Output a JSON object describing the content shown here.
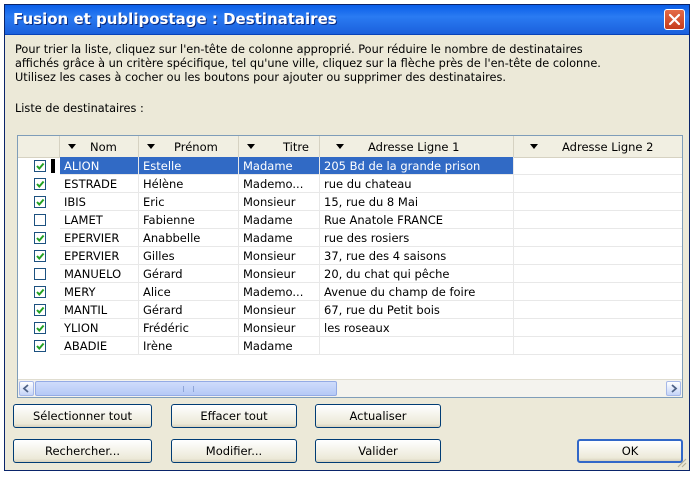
{
  "window": {
    "title": "Fusion et publipostage : Destinataires",
    "close_icon": "close-icon"
  },
  "description": {
    "line1": "Pour trier la liste, cliquez sur l'en-tête de colonne approprié. Pour réduire le nombre de destinataires",
    "line2": "affichés grâce à un critère spécifique, tel qu'une ville, cliquez sur la flèche près de l'en-tête de colonne.",
    "line3": "Utilisez les cases à cocher ou les boutons pour ajouter ou supprimer des destinataires."
  },
  "list": {
    "label": "Liste de destinataires :",
    "columns": [
      "Nom",
      "Prénom",
      "Titre",
      "Adresse Ligne 1",
      "Adresse Ligne 2"
    ],
    "rows": [
      {
        "checked": true,
        "selected": true,
        "nom": "ALION",
        "prenom": "Estelle",
        "titre": "Madame",
        "adresse1": "205 Bd de la grande prison",
        "adresse2": ""
      },
      {
        "checked": true,
        "selected": false,
        "nom": "ESTRADE",
        "prenom": "Hélène",
        "titre": "Mademo...",
        "adresse1": "rue du chateau",
        "adresse2": ""
      },
      {
        "checked": true,
        "selected": false,
        "nom": "IBIS",
        "prenom": "Eric",
        "titre": "Monsieur",
        "adresse1": "15, rue du 8 Mai",
        "adresse2": ""
      },
      {
        "checked": false,
        "selected": false,
        "nom": "LAMET",
        "prenom": "Fabienne",
        "titre": "Madame",
        "adresse1": "Rue Anatole FRANCE",
        "adresse2": ""
      },
      {
        "checked": true,
        "selected": false,
        "nom": "EPERVIER",
        "prenom": "Anabbelle",
        "titre": "Madame",
        "adresse1": "rue des rosiers",
        "adresse2": ""
      },
      {
        "checked": true,
        "selected": false,
        "nom": "EPERVIER",
        "prenom": "Gilles",
        "titre": "Monsieur",
        "adresse1": "37, rue des 4 saisons",
        "adresse2": ""
      },
      {
        "checked": false,
        "selected": false,
        "nom": "MANUELO",
        "prenom": "Gérard",
        "titre": "Monsieur",
        "adresse1": "20, du chat qui pêche",
        "adresse2": ""
      },
      {
        "checked": true,
        "selected": false,
        "nom": "MERY",
        "prenom": "Alice",
        "titre": "Mademo...",
        "adresse1": "Avenue du champ de foire",
        "adresse2": ""
      },
      {
        "checked": true,
        "selected": false,
        "nom": "MANTIL",
        "prenom": "Gérard",
        "titre": "Monsieur",
        "adresse1": "67, rue du Petit bois",
        "adresse2": ""
      },
      {
        "checked": true,
        "selected": false,
        "nom": "YLION",
        "prenom": "Frédéric",
        "titre": "Monsieur",
        "adresse1": "les roseaux",
        "adresse2": ""
      },
      {
        "checked": true,
        "selected": false,
        "nom": "ABADIE",
        "prenom": "Irène",
        "titre": "Madame",
        "adresse1": "",
        "adresse2": ""
      }
    ]
  },
  "buttons": {
    "select_all": "Sélectionner tout",
    "clear_all": "Effacer tout",
    "refresh": "Actualiser",
    "find": "Rechercher...",
    "edit": "Modifier...",
    "validate": "Valider",
    "ok": "OK"
  },
  "colors": {
    "title_bar": "#1b60dc",
    "selection": "#316ac5",
    "dialog_bg": "#ece9d8"
  }
}
